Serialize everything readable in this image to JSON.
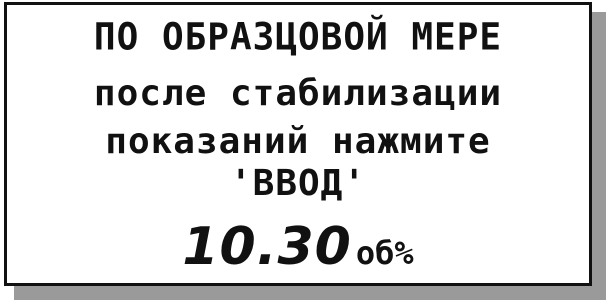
{
  "display": {
    "line1": "ПО ОБРАЗЦОВОЙ МЕРЕ",
    "line2": "после стабилизации",
    "line3": "показаний нажмите",
    "line4": "'ВВОД'",
    "value": "10.30",
    "unit": "об%"
  },
  "colors": {
    "text": "#111111",
    "background": "#ffffff",
    "border": "#111111",
    "shadow": "#9a9a9a"
  }
}
